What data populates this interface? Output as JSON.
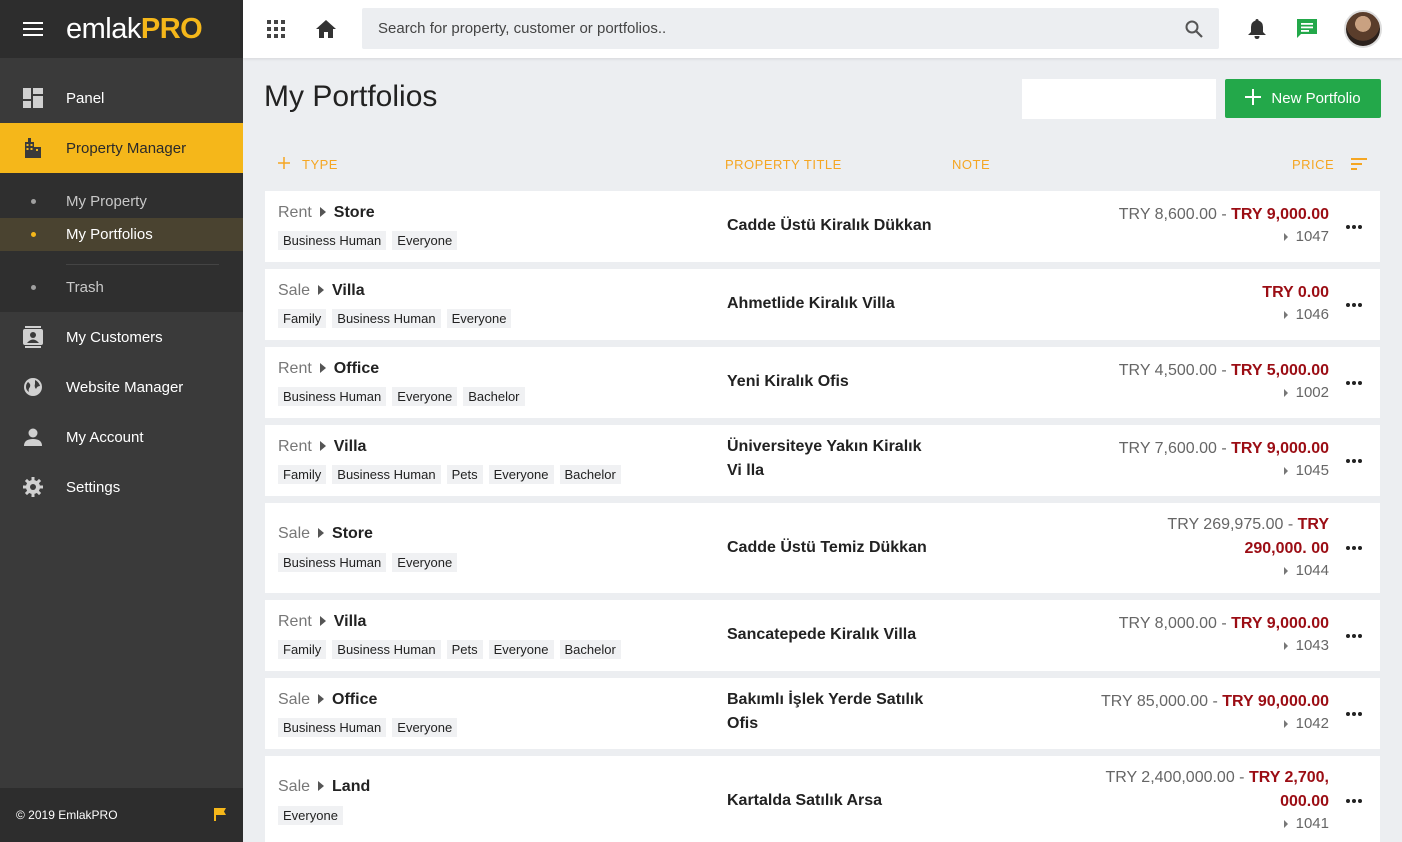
{
  "app": {
    "logo_part1": "emlak",
    "logo_part2": "PRO"
  },
  "search": {
    "placeholder": "Search for property, customer or portfolios.."
  },
  "sidebar": {
    "panel": "Panel",
    "property_manager": "Property Manager",
    "sub": {
      "my_property": "My Property",
      "my_portfolios": "My Portfolios",
      "trash": "Trash"
    },
    "my_customers": "My Customers",
    "website_manager": "Website Manager",
    "my_account": "My Account",
    "settings": "Settings",
    "footer": "© 2019 EmlakPRO"
  },
  "page": {
    "title": "My Portfolios",
    "new_button": "New Portfolio"
  },
  "columns": {
    "type": "TYPE",
    "title": "PROPERTY TITLE",
    "note": "NOTE",
    "price": "PRICE"
  },
  "rows": [
    {
      "mode": "Rent",
      "kind": "Store",
      "tags": [
        "Business Human",
        "Everyone"
      ],
      "title": "Cadde Üstü Kiralık Dükkan",
      "old_price": "TRY 8,600.00 - ",
      "new_price": "TRY 9,000.00",
      "id": "1047"
    },
    {
      "mode": "Sale",
      "kind": "Villa",
      "tags": [
        "Family",
        "Business Human",
        "Everyone"
      ],
      "title": "Ahmetlide Kiralık Villa",
      "old_price": "",
      "new_price": "TRY 0.00",
      "id": "1046"
    },
    {
      "mode": "Rent",
      "kind": "Office",
      "tags": [
        "Business Human",
        "Everyone",
        "Bachelor"
      ],
      "title": "Yeni Kiralık Ofis",
      "old_price": "TRY 4,500.00 - ",
      "new_price": "TRY 5,000.00",
      "id": "1002"
    },
    {
      "mode": "Rent",
      "kind": "Villa",
      "tags": [
        "Family",
        "Business Human",
        "Pets",
        "Everyone",
        "Bachelor"
      ],
      "title": "Üniversiteye Yakın Kiralık Vi lla",
      "old_price": "TRY 7,600.00 - ",
      "new_price": "TRY 9,000.00",
      "id": "1045"
    },
    {
      "mode": "Sale",
      "kind": "Store",
      "tags": [
        "Business Human",
        "Everyone"
      ],
      "title": "Cadde Üstü Temiz Dükkan",
      "old_price": "TRY 269,975.00 - ",
      "new_price": "TRY 290,000. 00",
      "id": "1044"
    },
    {
      "mode": "Rent",
      "kind": "Villa",
      "tags": [
        "Family",
        "Business Human",
        "Pets",
        "Everyone",
        "Bachelor"
      ],
      "title": "Sancatepede Kiralık Villa",
      "old_price": "TRY 8,000.00 - ",
      "new_price": "TRY 9,000.00",
      "id": "1043"
    },
    {
      "mode": "Sale",
      "kind": "Office",
      "tags": [
        "Business Human",
        "Everyone"
      ],
      "title": "Bakımlı İşlek Yerde Satılık Ofis",
      "old_price": "TRY 85,000.00 - ",
      "new_price": "TRY 90,000.00",
      "id": "1042"
    },
    {
      "mode": "Sale",
      "kind": "Land",
      "tags": [
        "Everyone"
      ],
      "title": "Kartalda Satılık Arsa",
      "old_price": "TRY 2,400,000.00 - ",
      "new_price": "TRY 2,700, 000.00",
      "id": "1041"
    }
  ],
  "colors": {
    "accent": "#f5b71a",
    "green": "#23a84a",
    "price_red": "#9b0d14"
  }
}
